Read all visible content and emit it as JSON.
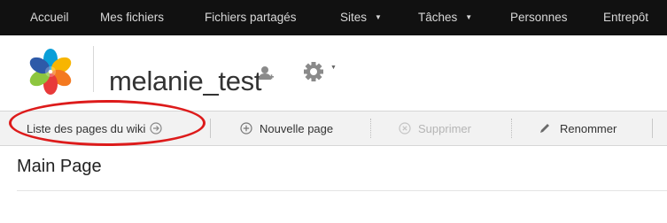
{
  "topnav": {
    "items": [
      {
        "label": "Accueil"
      },
      {
        "label": "Mes fichiers"
      },
      {
        "label": "Fichiers partagés"
      },
      {
        "label": "Sites",
        "caret": "▼"
      },
      {
        "label": "Tâches",
        "caret": "▼"
      },
      {
        "label": "Personnes"
      },
      {
        "label": "Entrepôt"
      }
    ]
  },
  "header": {
    "site_name": "melanie_test",
    "gear_caret": "▼"
  },
  "toolbar": {
    "wiki_pages_label": "Liste des pages du wiki",
    "new_page_label": "Nouvelle page",
    "delete_label": "Supprimer",
    "rename_label": "Renommer"
  },
  "page": {
    "title": "Main Page"
  },
  "colors": {
    "nav_bg": "#111111",
    "toolbar_bg": "#f2f2f2",
    "highlight": "#dd1b1b"
  }
}
